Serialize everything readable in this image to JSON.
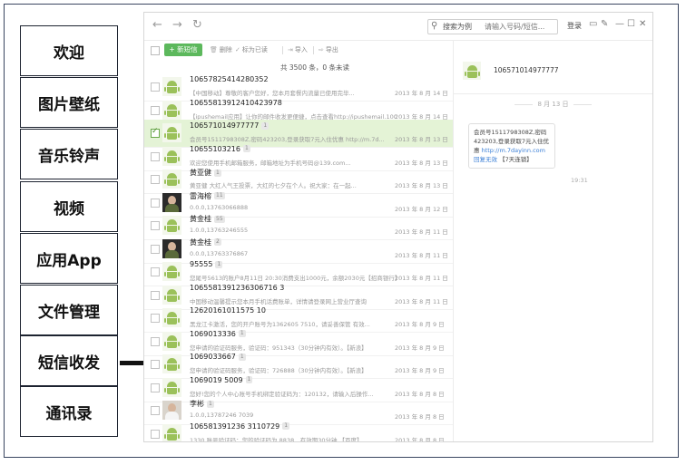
{
  "left_menu": {
    "items": [
      {
        "label": "欢迎"
      },
      {
        "label": "图片壁纸"
      },
      {
        "label": "音乐铃声"
      },
      {
        "label": "视频"
      },
      {
        "label": "应用App"
      },
      {
        "label": "文件管理"
      },
      {
        "label": "短信收发"
      },
      {
        "label": "通讯录"
      }
    ],
    "selected": "短信收发"
  },
  "app": {
    "nav": {
      "back": "←",
      "forward": "→",
      "refresh": "↻"
    },
    "search": {
      "label": "搜索为例",
      "placeholder": "请输入号码/短信..."
    },
    "login_label": "登录",
    "window_icons": [
      "▭",
      "✎",
      "—",
      "☐",
      "✕"
    ],
    "toolbar": {
      "new_label": "+ 新短信",
      "delete_label": "删除",
      "mark_read_label": "标为已读",
      "import_label": "导入",
      "export_label": "导出"
    },
    "count_text": "共 3500 条，0 条未读",
    "messages": [
      {
        "name": "10657825414280352",
        "badge": "",
        "preview": "【中国移动】尊敬的客户您好，您本月套餐内流量已使用完毕...",
        "date": "2013 年 8 月 14 日",
        "avatar": "android",
        "selected": false
      },
      {
        "name": "10655813912410423978",
        "badge": "",
        "preview": "【ipushemail应用】让你的邮件收发更便捷，点击查看http://ipushemail.100...",
        "date": "2013 年 8 月 14 日",
        "avatar": "android",
        "selected": false
      },
      {
        "name": "106571014977777",
        "badge": "1",
        "preview": "会员号1511798308Z,密码423203,登录获取7元入住优惠 http://m.7d...",
        "date": "2013 年 8 月 13 日",
        "avatar": "android",
        "selected": true
      },
      {
        "name": "10655103216",
        "badge": "1",
        "preview": "欢迎您使用手机邮箱服务，邮箱地址为手机号码@139.com...",
        "date": "2013 年 8 月 13 日",
        "avatar": "android",
        "selected": false
      },
      {
        "name": "黄亚健",
        "badge": "1",
        "preview": "黄亚健 大红人气王投票，大红的七夕在个人。祝大家：在一起...",
        "date": "2013 年 8 月 13 日",
        "avatar": "android",
        "selected": false
      },
      {
        "name": "雷海榕",
        "badge": "11",
        "preview": "0.0.0,13763066888",
        "date": "2013 年 8 月 12 日",
        "avatar": "photo-dark",
        "selected": false
      },
      {
        "name": "黄金桂",
        "badge": "55",
        "preview": "1.0.0,13763246555",
        "date": "2013 年 8 月 11 日",
        "avatar": "android",
        "selected": false
      },
      {
        "name": "黄金桂",
        "badge": "2",
        "preview": "0.0.0,13763376867",
        "date": "2013 年 8 月 11 日",
        "avatar": "photo-dark",
        "selected": false
      },
      {
        "name": "95555",
        "badge": "1",
        "preview": "您尾号5613的账户8月11日 20:30消费支出1000元，余额2030元【招商银行】",
        "date": "2013 年 8 月 11 日",
        "avatar": "android",
        "selected": false
      },
      {
        "name": "1065581391236306716 3",
        "badge": "",
        "preview": "中国移动温馨提示您本月手机话费账单，详情请登录网上营业厅查询",
        "date": "2013 年 8 月 11 日",
        "avatar": "android",
        "selected": false
      },
      {
        "name": "12620161011575 10",
        "badge": "",
        "preview": "黑龙江卡激活，您的开户账号为1362605 7510，请妥善保管 有效...",
        "date": "2013 年 8 月 9 日",
        "avatar": "android",
        "selected": false
      },
      {
        "name": "1069013336",
        "badge": "1",
        "preview": "您申请的验证码服务，验证码：951343（30分钟内有效）。【新浪】",
        "date": "2013 年 8 月 9 日",
        "avatar": "android",
        "selected": false
      },
      {
        "name": "1069033667",
        "badge": "1",
        "preview": "您申请的验证码服务，验证码：726888（30分钟内有效）。【新浪】",
        "date": "2013 年 8 月 9 日",
        "avatar": "android",
        "selected": false
      },
      {
        "name": "1069019 5009",
        "badge": "1",
        "preview": "您好!您的个人中心账号手机绑定验证码为：120132，请输入后操作...",
        "date": "2013 年 8 月 8 日",
        "avatar": "android",
        "selected": false
      },
      {
        "name": "李彬",
        "badge": "1",
        "preview": "1.0.0,13787246 7039",
        "date": "2013 年 8 月 8 日",
        "avatar": "photo-light",
        "selected": false
      },
      {
        "name": "106581391236 3110729",
        "badge": "1",
        "preview": "1330 账号验证码：您的验证码为 8838，有效期30分钟 【百度】",
        "date": "2013 年 8 月 8 日",
        "avatar": "android",
        "selected": false
      }
    ],
    "conversation": {
      "number": "106571014977777",
      "date": "8 月 13 日",
      "message_text": "会员号1511798308Z,密码423203,登录获取7元入住优惠",
      "message_link": "http://m.7dayinn.com 回复无效",
      "message_suffix": "【7天连锁】",
      "time": "19:31"
    }
  }
}
